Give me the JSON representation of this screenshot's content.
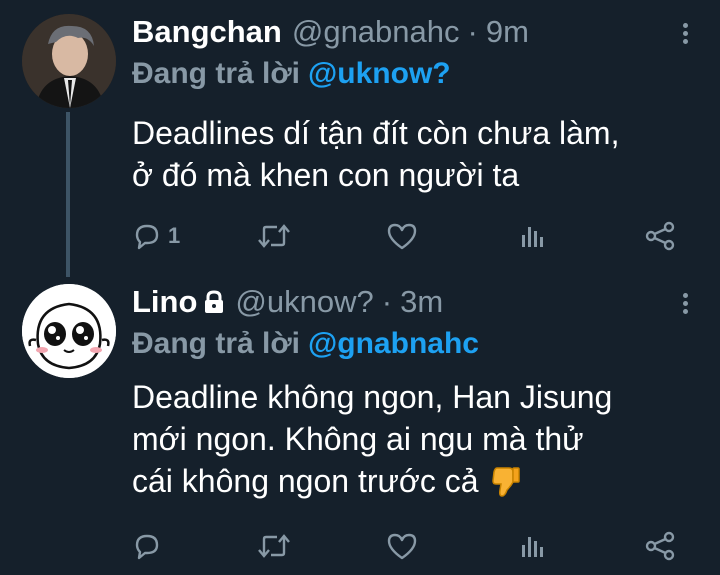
{
  "tweets": [
    {
      "name": "Bangchan",
      "handle": "@gnabnahc",
      "separator": "·",
      "time": "9m",
      "reply_prefix": "Đang trả lời",
      "reply_mention": "@uknow?",
      "body_lines": [
        "Deadlines dí tận đít còn chưa làm,",
        "ở đó mà khen con người ta"
      ],
      "reply_count": "1",
      "protected": false
    },
    {
      "name": "Lino",
      "handle": "@uknow?",
      "separator": "·",
      "time": "3m",
      "reply_prefix": "Đang trả lời",
      "reply_mention": "@gnabnahc",
      "body_lines": [
        "Deadline không ngon, Han Jisung",
        "mới ngon. Không ai ngu mà thử",
        "cái không ngon trước cả"
      ],
      "reply_count": "",
      "protected": true,
      "trailing_emoji": "thumbs-down"
    }
  ],
  "colors": {
    "background": "#15202b",
    "secondary_text": "#8899a6",
    "mention": "#1da1f2",
    "thread_line": "#3d5466"
  },
  "icons": [
    "reply-icon",
    "retweet-icon",
    "like-icon",
    "analytics-icon",
    "share-icon",
    "more-icon",
    "lock-icon"
  ]
}
